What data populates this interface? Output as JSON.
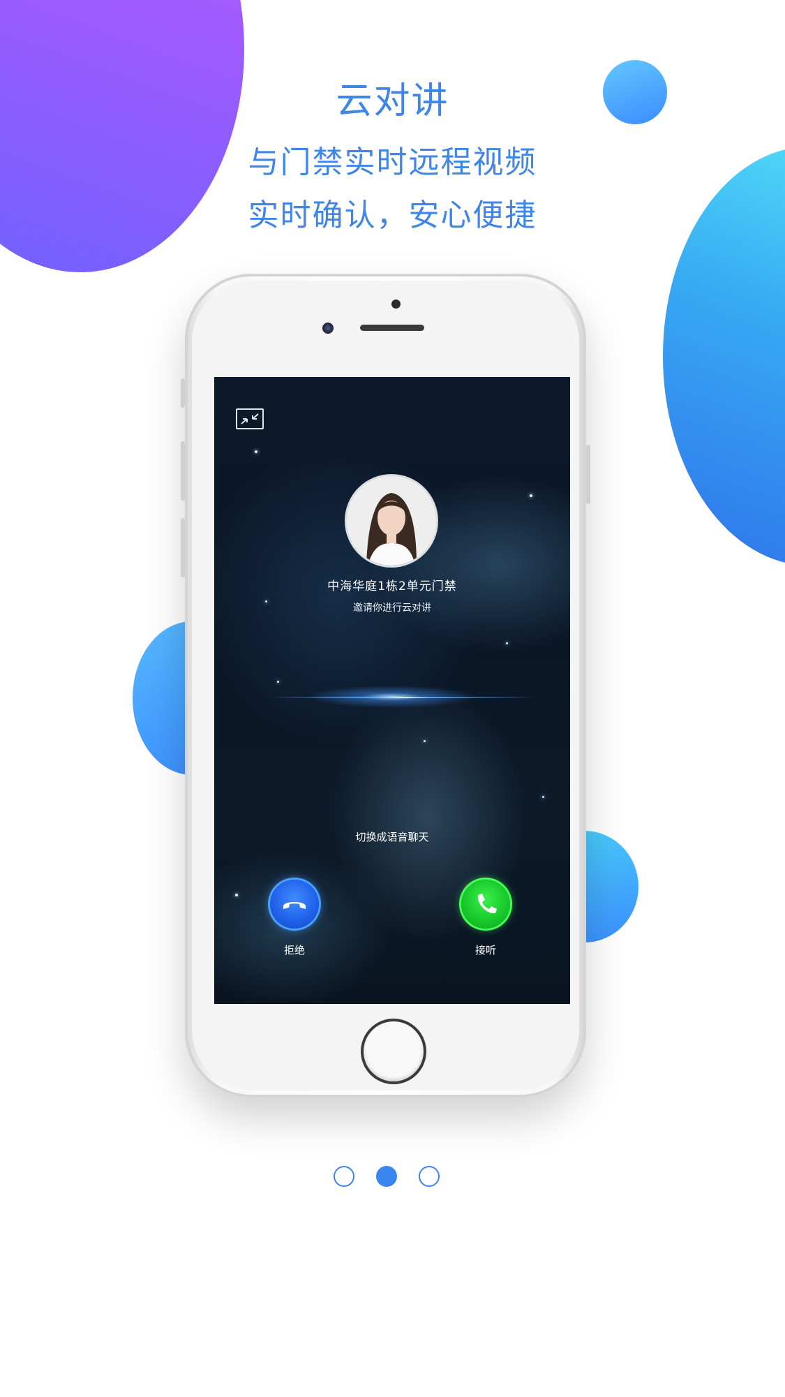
{
  "intro": {
    "title": "云对讲",
    "subtitle_line1": "与门禁实时远程视频",
    "subtitle_line2": "实时确认，安心便捷"
  },
  "call_screen": {
    "minimize_icon": "minimize-arrows-icon",
    "caller_name": "中海华庭1栋2单元门禁",
    "caller_message": "邀请你进行云对讲",
    "switch_voice_label": "切换成语音聊天",
    "reject_label": "拒绝",
    "answer_label": "接听",
    "reject_icon": "phone-hangup-icon",
    "answer_icon": "phone-answer-icon"
  },
  "pagination": {
    "total": 3,
    "active_index": 2
  },
  "colors": {
    "accent": "#3f86e8",
    "reject": "#1f5fe8",
    "answer": "#17c62a",
    "bubble_purple": "#9a5bff",
    "bubble_cyan": "#56e6f9"
  }
}
